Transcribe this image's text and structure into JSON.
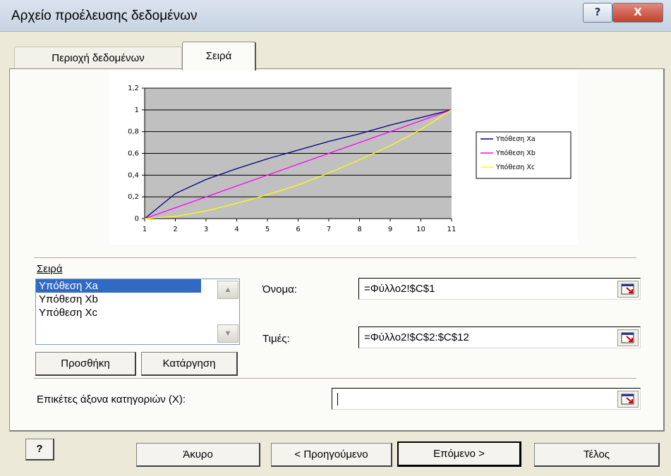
{
  "window": {
    "title": "Αρχείο προέλευσης δεδομένων",
    "help_glyph": "?",
    "close_glyph": "X"
  },
  "tabs": [
    {
      "label": "Περιοχή δεδομένων"
    },
    {
      "label": "Σειρά"
    }
  ],
  "chart_data": {
    "type": "line",
    "x": [
      1,
      2,
      3,
      4,
      5,
      6,
      7,
      8,
      9,
      10,
      11
    ],
    "categories": [
      "1",
      "2",
      "3",
      "4",
      "5",
      "6",
      "7",
      "8",
      "9",
      "10",
      "11"
    ],
    "y_ticks": [
      "0",
      "0,2",
      "0,4",
      "0,6",
      "0,8",
      "1",
      "1,2"
    ],
    "ylim": [
      0,
      1.2
    ],
    "grid": true,
    "legend": "right",
    "plot_background": "#c0c0c0",
    "series": [
      {
        "name": "Υπόθεση Xa",
        "color": "#000080",
        "values": [
          0.0,
          0.23,
          0.36,
          0.46,
          0.55,
          0.63,
          0.71,
          0.78,
          0.86,
          0.93,
          1.0
        ]
      },
      {
        "name": "Υπόθεση Xb",
        "color": "#ff00ff",
        "values": [
          0.0,
          0.1,
          0.2,
          0.3,
          0.4,
          0.5,
          0.6,
          0.7,
          0.8,
          0.9,
          1.0
        ]
      },
      {
        "name": "Υπόθεση Xc",
        "color": "#ffff00",
        "values": [
          0.0,
          0.02,
          0.07,
          0.14,
          0.22,
          0.31,
          0.42,
          0.54,
          0.67,
          0.82,
          1.0
        ]
      }
    ]
  },
  "series_section": {
    "label": "Σειρά",
    "list_items": [
      "Υπόθεση Xa",
      "Υπόθεση Xb",
      "Υπόθεση Xc"
    ],
    "selected_index": 0,
    "add_button": "Προσθήκη",
    "remove_button": "Κατάργηση"
  },
  "fields": {
    "name_label": "Όνομα:",
    "name_value": "=Φύλλο2!$C$1",
    "values_label": "Τιμές:",
    "values_value": "=Φύλλο2!$C$2:$C$12",
    "category_label": "Επικέτες άξονα κατηγοριών (X):",
    "category_value": ""
  },
  "footer": {
    "help_glyph": "?",
    "cancel": "Άκυρο",
    "back": "< Προηγούμενο",
    "next": "Επόμενο >",
    "finish": "Τέλος"
  }
}
